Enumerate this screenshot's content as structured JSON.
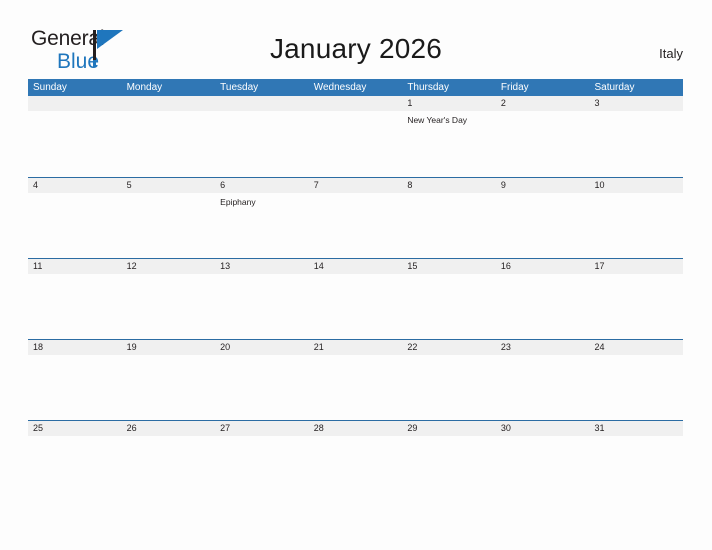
{
  "brand": {
    "word_one": "General",
    "word_two": "Blue",
    "triangle_icon": "triangle-flag-icon"
  },
  "header": {
    "title": "January 2026",
    "country": "Italy"
  },
  "colors": {
    "header_blue": "#3077b5",
    "rule_blue": "#2b6ca3",
    "date_band": "#f0f0f0",
    "brand_blue": "#1f76bd",
    "page_background": "#fdfdfd",
    "text": "#231f20"
  },
  "calendar": {
    "weekday_headers": [
      "Sunday",
      "Monday",
      "Tuesday",
      "Wednesday",
      "Thursday",
      "Friday",
      "Saturday"
    ],
    "weeks": [
      {
        "days": [
          {
            "date": "",
            "event": ""
          },
          {
            "date": "",
            "event": ""
          },
          {
            "date": "",
            "event": ""
          },
          {
            "date": "",
            "event": ""
          },
          {
            "date": "1",
            "event": "New Year's Day"
          },
          {
            "date": "2",
            "event": ""
          },
          {
            "date": "3",
            "event": ""
          }
        ]
      },
      {
        "days": [
          {
            "date": "4",
            "event": ""
          },
          {
            "date": "5",
            "event": ""
          },
          {
            "date": "6",
            "event": "Epiphany"
          },
          {
            "date": "7",
            "event": ""
          },
          {
            "date": "8",
            "event": ""
          },
          {
            "date": "9",
            "event": ""
          },
          {
            "date": "10",
            "event": ""
          }
        ]
      },
      {
        "days": [
          {
            "date": "11",
            "event": ""
          },
          {
            "date": "12",
            "event": ""
          },
          {
            "date": "13",
            "event": ""
          },
          {
            "date": "14",
            "event": ""
          },
          {
            "date": "15",
            "event": ""
          },
          {
            "date": "16",
            "event": ""
          },
          {
            "date": "17",
            "event": ""
          }
        ]
      },
      {
        "days": [
          {
            "date": "18",
            "event": ""
          },
          {
            "date": "19",
            "event": ""
          },
          {
            "date": "20",
            "event": ""
          },
          {
            "date": "21",
            "event": ""
          },
          {
            "date": "22",
            "event": ""
          },
          {
            "date": "23",
            "event": ""
          },
          {
            "date": "24",
            "event": ""
          }
        ]
      },
      {
        "days": [
          {
            "date": "25",
            "event": ""
          },
          {
            "date": "26",
            "event": ""
          },
          {
            "date": "27",
            "event": ""
          },
          {
            "date": "28",
            "event": ""
          },
          {
            "date": "29",
            "event": ""
          },
          {
            "date": "30",
            "event": ""
          },
          {
            "date": "31",
            "event": ""
          }
        ]
      }
    ]
  }
}
